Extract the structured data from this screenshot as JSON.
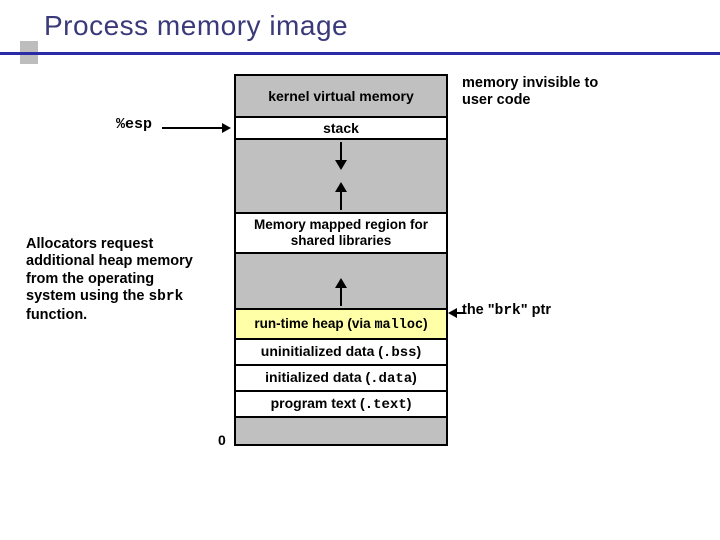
{
  "title": "Process memory image",
  "segments": {
    "kvm": "kernel virtual memory",
    "stack": "stack",
    "mmap_line1": "Memory mapped region for",
    "mmap_line2": "shared libraries",
    "heap_prefix": "run-time heap (via ",
    "heap_mono": "malloc",
    "heap_suffix": ")",
    "bss_prefix": "uninitialized data (",
    "bss_mono": ".bss",
    "bss_suffix": ")",
    "data_prefix": "initialized data (",
    "data_mono": ".data",
    "data_suffix": ")",
    "text_prefix": "program text (",
    "text_mono": ".text",
    "text_suffix": ")"
  },
  "labels": {
    "esp": "%esp",
    "kvm_note_l1": "memory invisible to",
    "kvm_note_l2": "user code",
    "brk_prefix": "the \"",
    "brk_mono": "brk",
    "brk_suffix": "\" ptr",
    "body_l1": "Allocators request",
    "body_l2": "additional heap memory",
    "body_l3": "from the operating",
    "body_l4_pre": "system using the ",
    "body_l4_mono": "sbrk",
    "body_l5": "function.",
    "zero": "0"
  }
}
